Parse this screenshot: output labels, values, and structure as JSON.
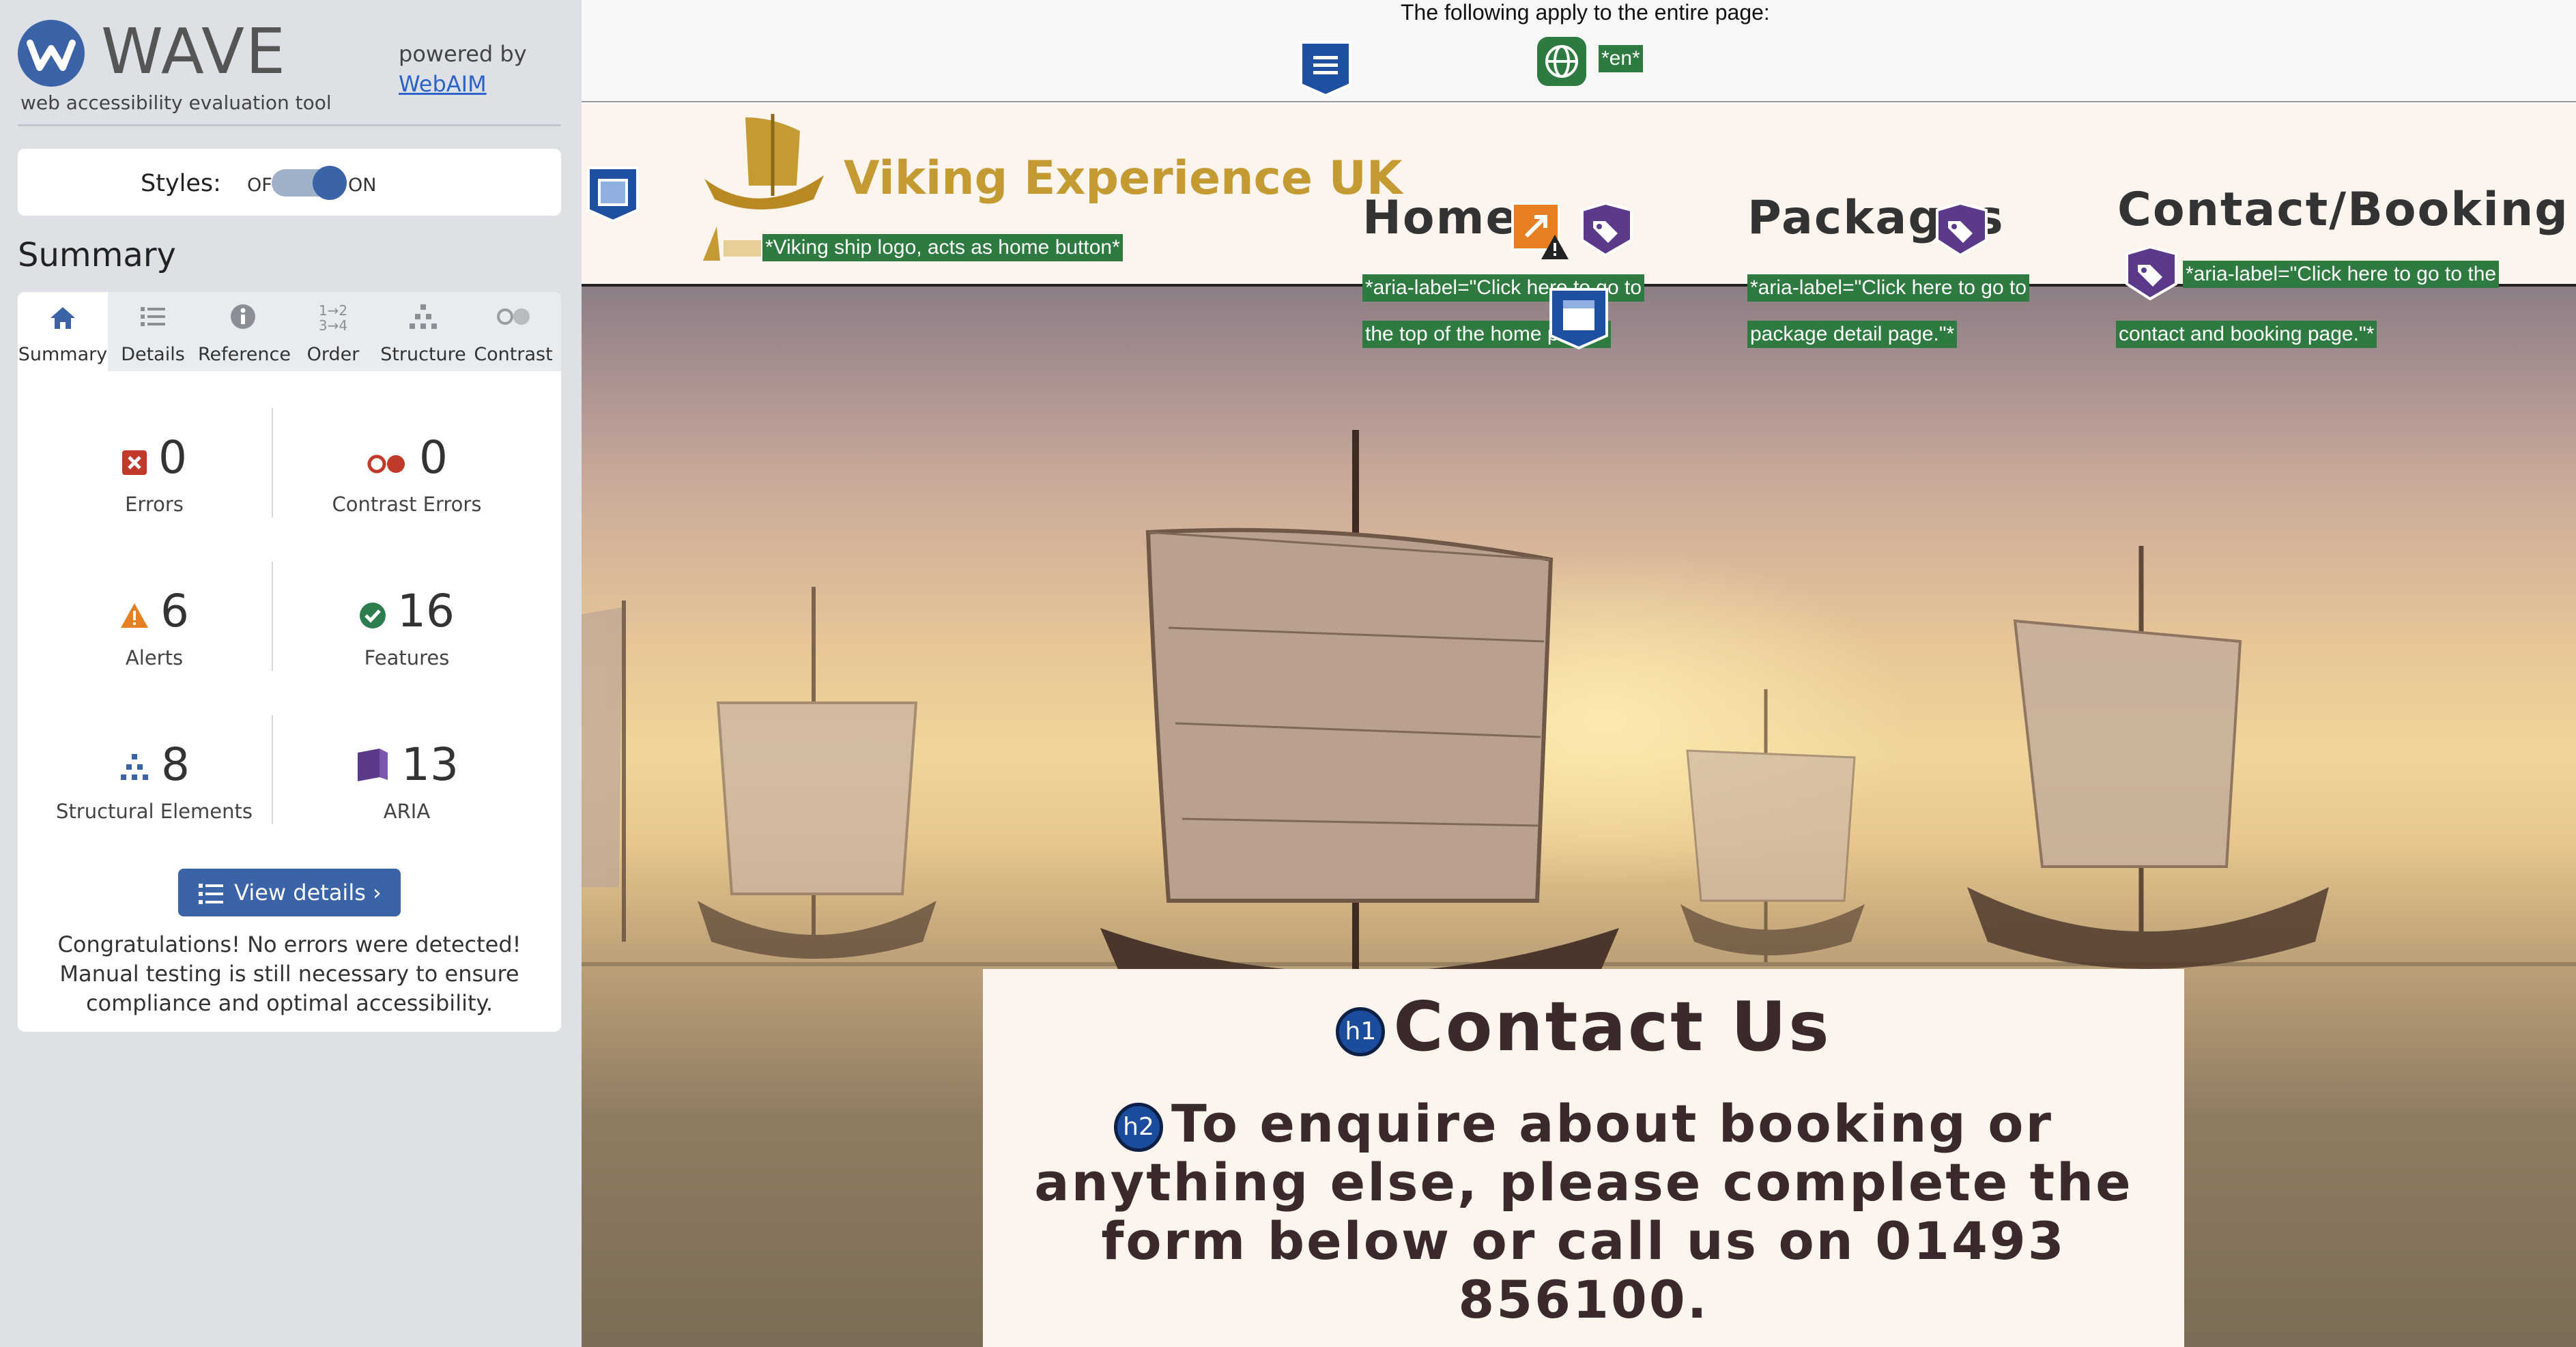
{
  "wave": {
    "title": "WAVE",
    "tagline": "web accessibility evaluation tool",
    "powered_by": "powered by",
    "webaim_link": "WebAIM",
    "styles_label": "Styles:",
    "styles_off": "OFF",
    "styles_on": "ON",
    "summary_heading": "Summary",
    "tabs": [
      {
        "label": "Summary",
        "icon": "home-icon"
      },
      {
        "label": "Details",
        "icon": "list-icon"
      },
      {
        "label": "Reference",
        "icon": "info-icon"
      },
      {
        "label": "Order",
        "icon": "order-icon"
      },
      {
        "label": "Structure",
        "icon": "structure-icon"
      },
      {
        "label": "Contrast",
        "icon": "contrast-icon"
      }
    ],
    "metrics": [
      {
        "count": "0",
        "label": "Errors",
        "icon": "error-icon",
        "color": "#c0392b"
      },
      {
        "count": "0",
        "label": "Contrast Errors",
        "icon": "contrast-error-icon",
        "color": "#c0392b"
      },
      {
        "count": "6",
        "label": "Alerts",
        "icon": "alert-icon",
        "color": "#e67e22"
      },
      {
        "count": "16",
        "label": "Features",
        "icon": "feature-icon",
        "color": "#2e7d4f"
      },
      {
        "count": "8",
        "label": "Structural Elements",
        "icon": "structure-icon",
        "color": "#3a63a8"
      },
      {
        "count": "13",
        "label": "ARIA",
        "icon": "aria-icon",
        "color": "#5b3a8c"
      }
    ],
    "view_details": "View details ›",
    "congrats": "Congratulations! No errors were detected! Manual testing is still necessary to ensure compliance and optimal accessibility."
  },
  "page": {
    "entire_page_note": "The following apply to the entire page:",
    "lang_label": "*en*",
    "brand_name": "Viking Experience UK",
    "logo_alt_label": "*Viking ship logo, acts as home button*",
    "nav": [
      {
        "label": "Home",
        "aria_line1": "*aria-label=\"Click here to go to",
        "aria_line2": "the top of the home page\"*"
      },
      {
        "label": "Packages",
        "aria_line1": "*aria-label=\"Click here to go to",
        "aria_line2": "package detail page.\"*"
      },
      {
        "label": "Contact/Booking",
        "aria_line1": "*aria-label=\"Click here to go to the",
        "aria_line2": "contact and booking page.\"*"
      }
    ],
    "h1_badge": "h1",
    "h2_badge": "h2",
    "contact_title": "Contact Us",
    "contact_subtitle": "To enquire about booking or anything else, please complete the form below or call us on 01493 856100."
  },
  "colors": {
    "wave_blue": "#3a63a8",
    "feature_green": "#2f7a40",
    "aria_purple": "#5b3a8c",
    "brand_gold": "#c49a32",
    "sidebar_bg": "#dde1e6"
  }
}
